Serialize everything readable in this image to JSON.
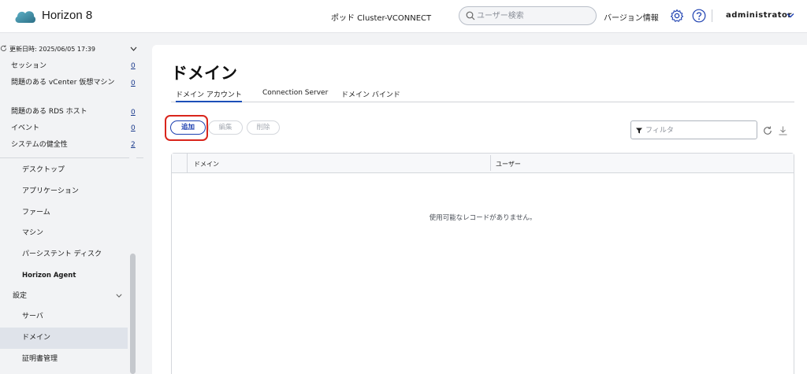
{
  "header": {
    "app_title": "Horizon 8",
    "pod": "ポッド Cluster-VCONNECT",
    "search_placeholder": "ユーザー検索",
    "version_info": "バージョン情報",
    "user": "administrator",
    "icons": [
      "cloud-logo",
      "search-icon",
      "gear-icon",
      "help-icon",
      "chevron-down-icon"
    ]
  },
  "sidebar": {
    "updated": "更新日時: 2025/06/05 17:39",
    "stats": [
      {
        "label": "セッション",
        "count": "0"
      },
      {
        "label": "問題のある vCenter 仮想マシン",
        "count": "0"
      },
      {
        "label": "問題のある RDS ホスト",
        "count": "0"
      },
      {
        "label": "イベント",
        "count": "0"
      },
      {
        "label": "システムの健全性",
        "count": "2"
      }
    ],
    "nav": [
      {
        "label": "デスクトップ"
      },
      {
        "label": "アプリケーション"
      },
      {
        "label": "ファーム"
      },
      {
        "label": "マシン"
      },
      {
        "label": "パーシステント ディスク"
      },
      {
        "label": "Horizon Agent"
      }
    ],
    "group": "設定",
    "settings_items": [
      {
        "label": "サーバ"
      },
      {
        "label": "ドメイン"
      },
      {
        "label": "証明書管理"
      }
    ]
  },
  "main": {
    "title": "ドメイン",
    "tabs": [
      "ドメイン アカウント",
      "Connection Server",
      "ドメイン バインド"
    ],
    "buttons": {
      "add": "追加",
      "edit": "編集",
      "delete": "削除"
    },
    "filter_placeholder": "フィルタ",
    "columns": [
      "ドメイン",
      "ユーザー"
    ],
    "empty_message": "使用可能なレコードがありません。"
  },
  "colors": {
    "accent": "#1c3fb0",
    "highlight": "#d9251c",
    "active_nav": "#dfe3ea"
  }
}
